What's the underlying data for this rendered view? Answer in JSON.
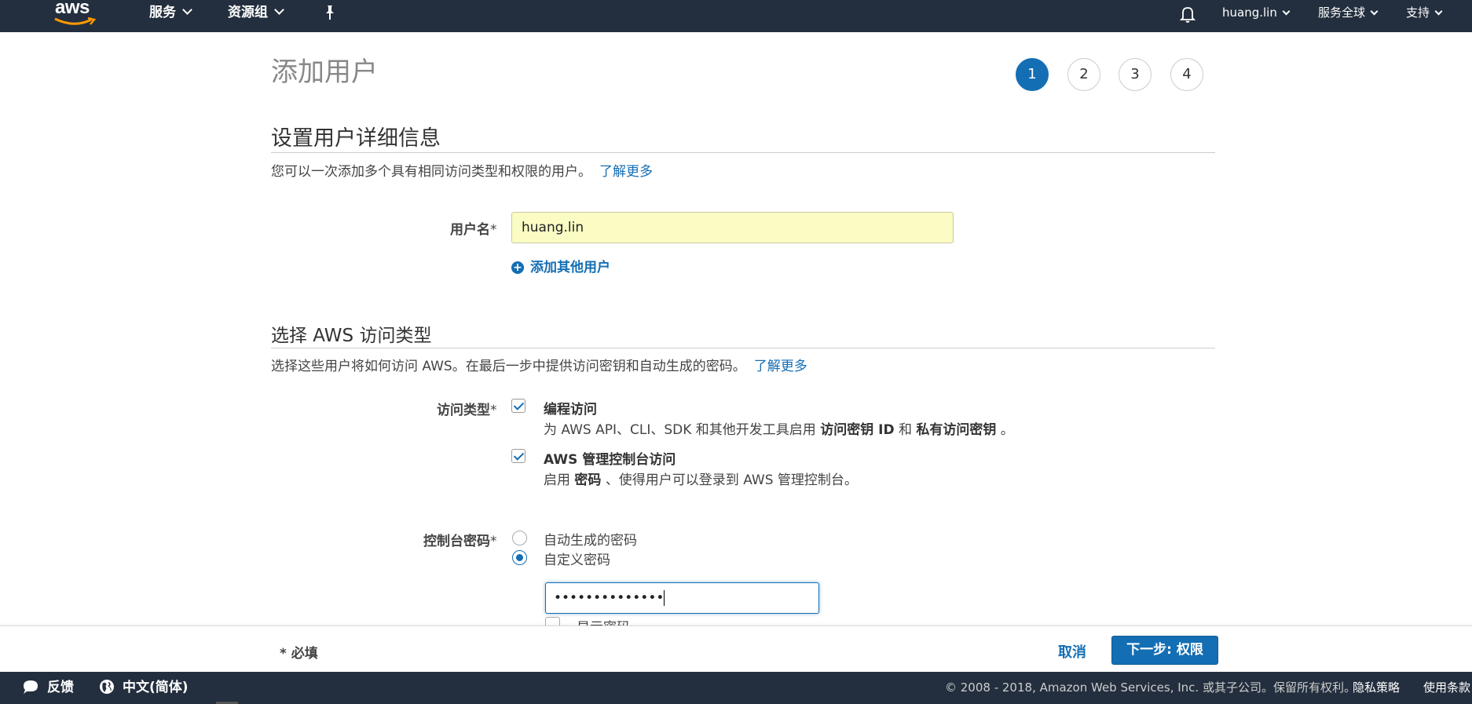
{
  "topnav": {
    "logo": "aws",
    "services": "服务",
    "resource_groups": "资源组",
    "user": "huang.lin",
    "region": "服务全球",
    "support": "支持"
  },
  "page": {
    "title": "添加用户",
    "steps": [
      "1",
      "2",
      "3",
      "4"
    ],
    "active_step": "1"
  },
  "details": {
    "title": "设置用户详细信息",
    "description": "您可以一次添加多个具有相同访问类型和权限的用户。",
    "learn_more": "了解更多",
    "username_label": "用户名",
    "required_mark": "*",
    "username_value": "huang.lin",
    "add_user": "添加其他用户"
  },
  "access": {
    "title": "选择 AWS 访问类型",
    "description": "选择这些用户将如何访问 AWS。在最后一步中提供访问密钥和自动生成的密码。",
    "learn_more": "了解更多",
    "type_label": "访问类型",
    "programmatic": {
      "title": "编程访问",
      "desc_prefix": "为 AWS API、CLI、SDK 和其他开发工具启用",
      "desc_b1": "访问密钥 ID",
      "desc_and": "和",
      "desc_b2": "私有访问密钥",
      "desc_suffix": "。",
      "checked": true
    },
    "console": {
      "title": "AWS 管理控制台访问",
      "desc_prefix": "启用",
      "desc_b1": "密码",
      "desc_suffix": "、使得用户可以登录到 AWS 管理控制台。",
      "checked": true
    },
    "password_label": "控制台密码",
    "auto_password": "自动生成的密码",
    "custom_password": "自定义密码",
    "password_value": "••••••••••••••",
    "show_password": "显示密码"
  },
  "actionbar": {
    "required_note": "* 必填",
    "cancel": "取消",
    "next": "下一步: 权限"
  },
  "footer": {
    "feedback": "反馈",
    "language": "中文(简体)",
    "copyright": "© 2008 - 2018, Amazon Web Services, Inc. 或其子公司。保留所有权利。",
    "privacy": "隐私策略",
    "terms": "使用条款"
  },
  "colors": {
    "nav_bg": "#232f3e",
    "accent": "#146eb4",
    "autofill_bg": "#fafcc4"
  }
}
